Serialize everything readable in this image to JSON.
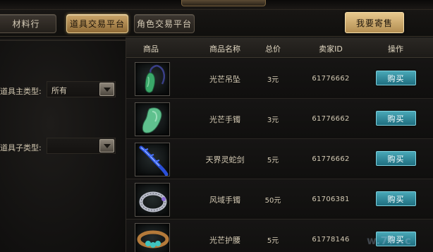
{
  "tabs": [
    {
      "label": "材料行",
      "active": false
    },
    {
      "label": "道具交易平台",
      "active": true
    },
    {
      "label": "角色交易平台",
      "active": false
    }
  ],
  "consign_button": "我要寄售",
  "filters": {
    "main_type_label": "道具主类型:",
    "main_type_value": "所有",
    "sub_type_label": "道具子类型:",
    "sub_type_value": ""
  },
  "table": {
    "headers": [
      "商品",
      "商品名称",
      "总价",
      "卖家ID",
      "操作"
    ],
    "rows": [
      {
        "icon": "jade-pendant-icon",
        "name": "光芒吊坠",
        "price": "3元",
        "seller_id": "61776662",
        "action": "购买"
      },
      {
        "icon": "jade-bracelet-icon",
        "name": "光芒手镯",
        "price": "3元",
        "seller_id": "61776662",
        "action": "购买"
      },
      {
        "icon": "blue-snake-sword-icon",
        "name": "天界灵蛇剑",
        "price": "5元",
        "seller_id": "61776662",
        "action": "购买"
      },
      {
        "icon": "silver-bracelet-icon",
        "name": "风域手镯",
        "price": "50元",
        "seller_id": "61706381",
        "action": "购买"
      },
      {
        "icon": "gem-belt-icon",
        "name": "光芒护腰",
        "price": "5元",
        "seller_id": "61778146",
        "action": "购买"
      }
    ]
  },
  "watermark": "w.77..c",
  "colors": {
    "active_tab": "#caa56a",
    "buy_button": "#2a8597",
    "consign_button": "#d4b47a"
  }
}
